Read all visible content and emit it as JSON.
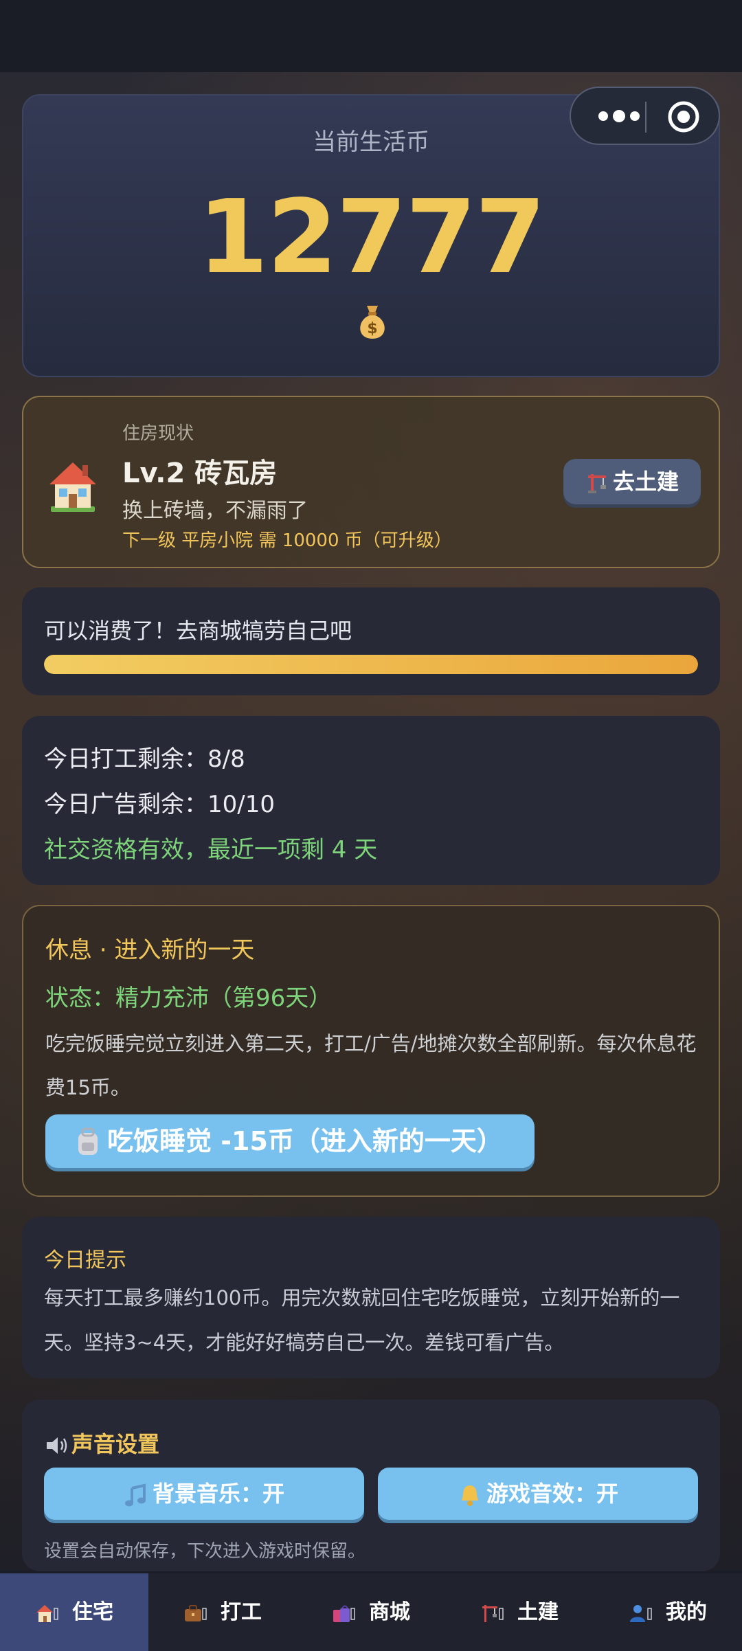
{
  "coins": {
    "label": "当前生活币",
    "value": "12777"
  },
  "housing": {
    "section_label": "住房现状",
    "title": "Lv.2 砖瓦房",
    "description": "换上砖墙，不漏雨了",
    "next_level": "下一级 平房小院 需 10000 币（可升级）",
    "build_button": "去土建"
  },
  "progress": {
    "text": "可以消费了！去商城犒劳自己吧",
    "percent": 100
  },
  "stats": {
    "work_remaining": "今日打工剩余：8/8",
    "ads_remaining": "今日广告剩余：10/10",
    "social": "社交资格有效，最近一项剩 4 天"
  },
  "rest": {
    "title": "休息 · 进入新的一天",
    "status": "状态：精力充沛（第96天）",
    "description": "吃完饭睡完觉立刻进入第二天，打工/广告/地摊次数全部刷新。每次休息花费15币。",
    "button": "吃饭睡觉 -15币（进入新的一天）"
  },
  "tip": {
    "title": "今日提示",
    "text": "每天打工最多赚约100币。用完次数就回住宅吃饭睡觉，立刻开始新的一天。坚持3~4天，才能好好犒劳自己一次。差钱可看广告。"
  },
  "sound": {
    "title": "声音设置",
    "bgm_button": "背景音乐：开",
    "sfx_button": "游戏音效：开",
    "note": "设置会自动保存，下次进入游戏时保留。"
  },
  "tabs": [
    {
      "label": "住宅",
      "icon": "house-icon",
      "active": true
    },
    {
      "label": "打工",
      "icon": "briefcase-icon",
      "active": false
    },
    {
      "label": "商城",
      "icon": "shopping-bags-icon",
      "active": false
    },
    {
      "label": "土建",
      "icon": "construction-crane-icon",
      "active": false
    },
    {
      "label": "我的",
      "icon": "user-icon",
      "active": false
    }
  ],
  "colors": {
    "accent_gold": "#f0c95a",
    "green": "#7ed47a",
    "button_blue": "#78c1ef",
    "active_tab": "#3d4a79"
  }
}
